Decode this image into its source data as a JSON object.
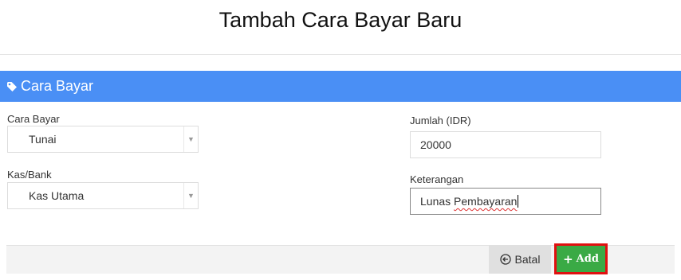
{
  "page": {
    "title": "Tambah Cara Bayar Baru"
  },
  "panel": {
    "title": "Cara Bayar",
    "icon": "tag-icon"
  },
  "form": {
    "cara_bayar": {
      "label": "Cara Bayar",
      "value": "Tunai"
    },
    "kas_bank": {
      "label": "Kas/Bank",
      "value": "Kas Utama"
    },
    "jumlah": {
      "label": "Jumlah (IDR)",
      "value": "20000"
    },
    "keterangan": {
      "label": "Keterangan",
      "value_prefix": "Lunas ",
      "value_misspelled": "Pembayaran"
    }
  },
  "footer": {
    "cancel_label": "Batal",
    "cancel_icon": "circle-arrow-left-icon",
    "add_label": "Add",
    "add_icon": "plus-icon"
  },
  "colors": {
    "panel_header": "#4a8ff5",
    "add_button": "#3aaa45",
    "add_button_highlight": "#e01010"
  }
}
